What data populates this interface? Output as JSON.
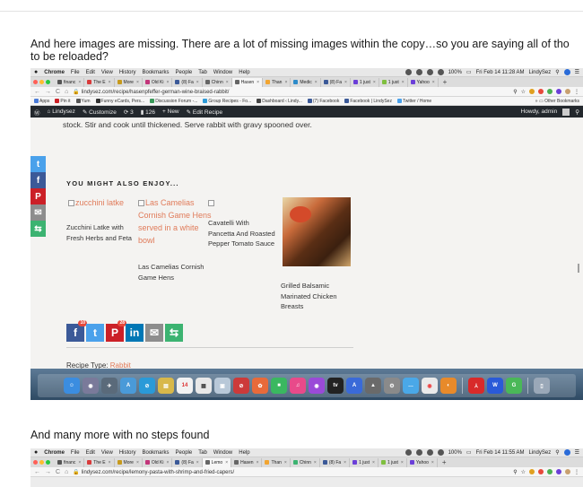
{
  "paragraphs": {
    "p1": "And here images are missing. There are a lot of missing images within the copy…so you are saying all of tho",
    "p2": "to be reloaded?",
    "p3": "And many more with no steps found"
  },
  "mac_menubar": {
    "app": "Chrome",
    "menus": [
      "File",
      "Edit",
      "View",
      "History",
      "Bookmarks",
      "People",
      "Tab",
      "Window",
      "Help"
    ],
    "battery": "100%",
    "time_1": "Fri Feb 14 11:28 AM",
    "time_2": "Fri Feb 14 11:55 AM",
    "user": "LindySez"
  },
  "tabs_1": [
    {
      "label": "financ",
      "color": "#555555"
    },
    {
      "label": "The E",
      "color": "#d83a3a"
    },
    {
      "label": "More",
      "color": "#c79a1d"
    },
    {
      "label": "Old Ki",
      "color": "#c2357a"
    },
    {
      "label": "(8) Fa",
      "color": "#3b5998"
    },
    {
      "label": "Chinn",
      "color": "#666666"
    },
    {
      "label": "Hasen",
      "color": "#666666",
      "active": true
    },
    {
      "label": "Than",
      "color": "#f2a531"
    },
    {
      "label": "Medic",
      "color": "#2d8bc9"
    },
    {
      "label": "(8) Fa",
      "color": "#3b5998"
    },
    {
      "label": "1 just",
      "color": "#6b3fd8"
    },
    {
      "label": "1 just",
      "color": "#7fbf3f"
    },
    {
      "label": "Yahoo",
      "color": "#6b3fd8"
    }
  ],
  "tabs_2": [
    {
      "label": "financ",
      "color": "#555555"
    },
    {
      "label": "The E",
      "color": "#d83a3a"
    },
    {
      "label": "More",
      "color": "#c79a1d"
    },
    {
      "label": "Old Ki",
      "color": "#c2357a"
    },
    {
      "label": "(8) Fa",
      "color": "#3b5998"
    },
    {
      "label": "Lemo",
      "color": "#666666",
      "active": true
    },
    {
      "label": "Hasen",
      "color": "#666666"
    },
    {
      "label": "Than",
      "color": "#f2a531"
    },
    {
      "label": "Chinn",
      "color": "#3cb371"
    },
    {
      "label": "(8) Fa",
      "color": "#3b5998"
    },
    {
      "label": "1 just",
      "color": "#6b3fd8"
    },
    {
      "label": "1 just",
      "color": "#7fbf3f"
    },
    {
      "label": "Yahoo",
      "color": "#6b3fd8"
    }
  ],
  "address_1": "lindysez.com/recipe/hasenpfeffer-german-wine-braised-rabbit/",
  "address_2": "lindysez.com/recipe/lemony-pasta-with-shrimp-and-fried-capers/",
  "bookmarks": {
    "items": [
      "Apps",
      "Pin it",
      "Yum",
      "Funny eCards, Pers...",
      "Discussion Forum -...",
      "Group Recipes - Fo...",
      "Dashboard ‹ Lindy...",
      "(7) Facebook",
      "Facebook | LindySez",
      "Twitter / Home"
    ],
    "other": "Other Bookmarks"
  },
  "wp_admin": {
    "site": "Lindysez",
    "customize": "Customize",
    "revisions": "3",
    "comments": "126",
    "new": "New",
    "edit": "Edit Recipe",
    "howdy": "Howdy, admin"
  },
  "page": {
    "stock_text": "stock. Stir and cook until thickened. Serve rabbit with gravy spooned over.",
    "you_might": "YOU MIGHT ALSO ENJOY...",
    "r1_alt": "zucchini latke",
    "r1_title_1": "Zucchini Latke with",
    "r1_title_2": "Fresh Herbs and Feta",
    "r2_alt_1": "Las Camelias",
    "r2_alt_2": "Cornish Game Hens",
    "r2_alt_3": "served in a white",
    "r2_alt_4": "bowl",
    "r2_title_1": "Las Camelias Cornish",
    "r2_title_2": "Game Hens",
    "r3_title_1": "Cavatelli With",
    "r3_title_2": "Pancetta And Roasted",
    "r3_title_3": "Pepper Tomato Sauce",
    "r4_title_1": "Grilled Balsamic",
    "r4_title_2": "Marinated Chicken",
    "r4_title_3": "Breasts",
    "share_fb_count": "10",
    "share_pi_count": "28",
    "recipe_type_label": "Recipe Type:",
    "recipe_type_value": "Rabbit"
  },
  "dock": {
    "calendar_day": "14"
  }
}
